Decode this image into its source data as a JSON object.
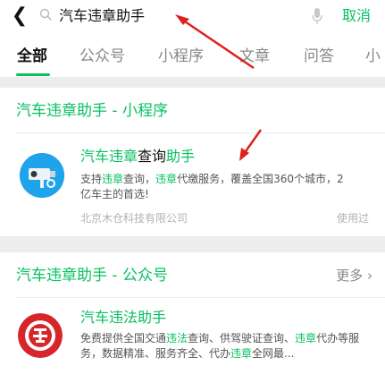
{
  "search": {
    "query": "汽车违章助手",
    "cancel_label": "取消"
  },
  "tabs": [
    {
      "label": "全部",
      "active": true
    },
    {
      "label": "公众号",
      "active": false
    },
    {
      "label": "小程序",
      "active": false
    },
    {
      "label": "文章",
      "active": false
    },
    {
      "label": "问答",
      "active": false
    },
    {
      "label": "小",
      "active": false
    }
  ],
  "mini_programs": {
    "section_title": "汽车违章助手 - 小程序",
    "items": [
      {
        "icon": "camera-icon",
        "title_hl_1": "汽车违章",
        "title_mid": "查询",
        "title_hl_2": "助手",
        "desc_1": "支持",
        "desc_hl_1": "违章",
        "desc_2": "查询，",
        "desc_hl_2": "违章",
        "desc_3": "代缴服务，覆盖全国360个城市，2亿车主的首选!",
        "company": "北京木仓科技有限公司",
        "used_label": "使用过"
      }
    ]
  },
  "official_accounts": {
    "section_title": "汽车违章助手 - 公众号",
    "more_label": "更多",
    "items": [
      {
        "icon": "traffic-badge-icon",
        "title": "汽车违法助手",
        "desc_1": "免费提供全国交通",
        "desc_hl_1": "违法",
        "desc_2": "查询、供驾驶证查询、",
        "desc_hl_2": "违章",
        "desc_3": "代办等服务，数据精准、服务齐全、代办",
        "desc_hl_3": "违章",
        "desc_4": "全网最..."
      }
    ]
  },
  "colors": {
    "accent": "#07c160",
    "annotation_arrow": "#e0201f"
  }
}
